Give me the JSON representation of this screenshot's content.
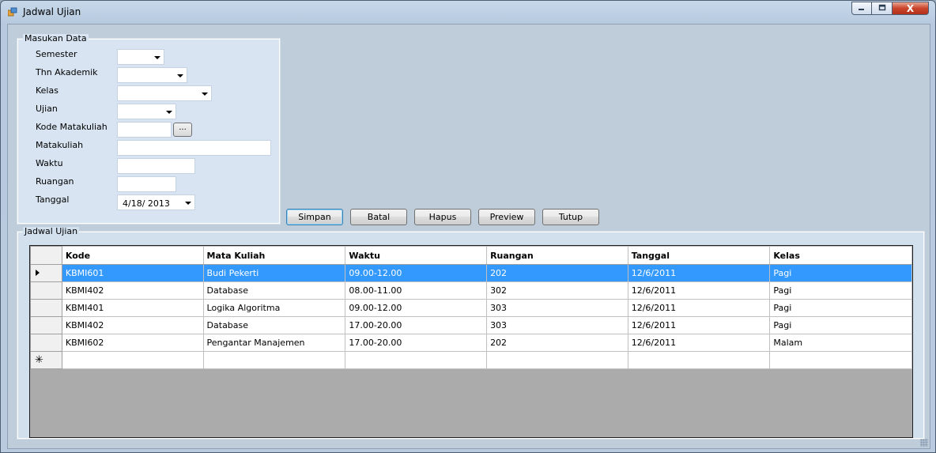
{
  "window": {
    "title": "Jadwal Ujian",
    "close_glyph": "X"
  },
  "masukan": {
    "group_label": "Masukan Data",
    "labels": {
      "semester": "Semester",
      "thn_akademik": "Thn Akademik",
      "kelas": "Kelas",
      "ujian": "Ujian",
      "kode_matakuliah": "Kode Matakuliah",
      "matakuliah": "Matakuliah",
      "waktu": "Waktu",
      "ruangan": "Ruangan",
      "tanggal": "Tanggal"
    },
    "values": {
      "semester": "",
      "thn_akademik": "",
      "kelas": "",
      "ujian": "",
      "kode_matakuliah": "",
      "matakuliah": "",
      "waktu": "",
      "ruangan": "",
      "tanggal": "4/18/ 2013"
    },
    "browse_label": "..."
  },
  "buttons": {
    "simpan": "Simpan",
    "batal": "Batal",
    "hapus": "Hapus",
    "preview": "Preview",
    "tutup": "Tutup"
  },
  "jadwal": {
    "group_label": "Jadwal Ujian",
    "columns": [
      "Kode",
      "Mata Kuliah",
      "Waktu",
      "Ruangan",
      "Tanggal",
      "Kelas"
    ],
    "rows": [
      [
        "KBMI601",
        "Budi Pekerti",
        "09.00-12.00",
        "202",
        "12/6/2011",
        "Pagi"
      ],
      [
        "KBMI402",
        "Database",
        "08.00-11.00",
        "302",
        "12/6/2011",
        "Pagi"
      ],
      [
        "KBMI401",
        "Logika Algoritma",
        "09.00-12.00",
        "303",
        "12/6/2011",
        "Pagi"
      ],
      [
        "KBMI402",
        "Database",
        "17.00-20.00",
        "303",
        "12/6/2011",
        "Pagi"
      ],
      [
        "KBMI602",
        "Pengantar Manajemen",
        "17.00-20.00",
        "202",
        "12/6/2011",
        "Malam"
      ]
    ],
    "selected_row": 0,
    "new_row_glyph": "✳"
  },
  "colors": {
    "selection": "#3399ff",
    "grid_background": "#ababab",
    "close_button": "#c9452b"
  },
  "icons": {
    "app": "app-window-icon",
    "minimize": "minimize-icon",
    "maximize": "maximize-icon",
    "close": "close-icon",
    "current_row": "row-pointer-icon",
    "new_row": "new-row-icon"
  }
}
